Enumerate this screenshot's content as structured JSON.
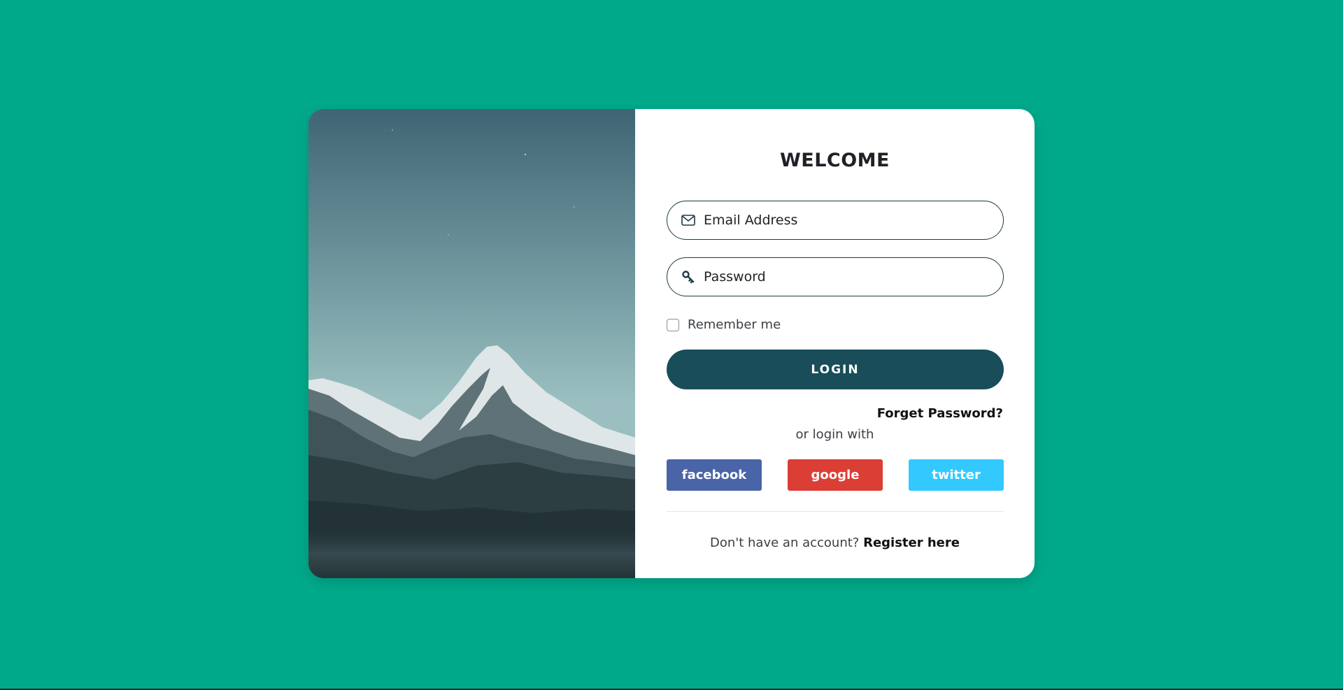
{
  "colors": {
    "background": "#00a98a",
    "login_button": "#184d59",
    "facebook": "#4a64a8",
    "google": "#db3e35",
    "twitter": "#33c9ff"
  },
  "login": {
    "title": "WELCOME",
    "email": {
      "placeholder": "Email Address",
      "value": "",
      "icon": "envelope-icon"
    },
    "password": {
      "placeholder": "Password",
      "value": "",
      "icon": "key-icon"
    },
    "remember_label": "Remember me",
    "remember_checked": false,
    "login_button": "LOGIN",
    "forget_password": "Forget Password?",
    "or_login_with": "or login with",
    "social": {
      "facebook": "facebook",
      "google": "google",
      "twitter": "twitter"
    },
    "register_prompt": "Don't have an account?",
    "register_link": "Register here"
  }
}
